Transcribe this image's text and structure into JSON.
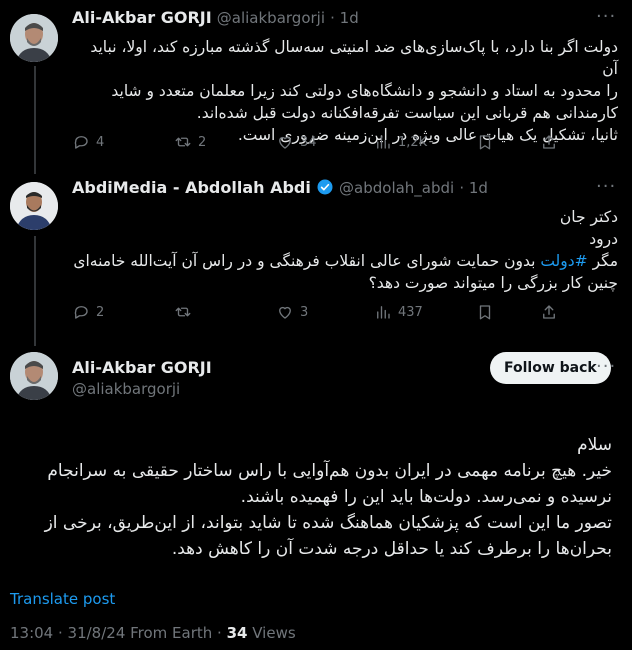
{
  "tweet1": {
    "name": "Ali-Akbar GORJI",
    "handle": "@aliakbargorji",
    "time": "· 1d",
    "lines": [
      "دولت اگر بنا دارد، با پاک‌سازی‌های ضد امنیتی سه‌سال گذشته مبارزه کند، اولا، نباید آن",
      "را محدود به استاد و دانشجو و دانشگاه‌های دولتی کند زیرا معلمان متعدد و شاید",
      "کارمندانی هم قربانی این سیاست تفرقه‌افکنانه دولت قبل شده‌اند.",
      "ثانیا، تشکیل یک هیات عالی ویژه در این‌زمینه ضروری است."
    ],
    "replies": "4",
    "retweets": "2",
    "likes": "34",
    "views": "1,2K"
  },
  "tweet2": {
    "name": "AbdiMedia - Abdollah Abdi",
    "handle": "@abdolah_abdi",
    "time": "· 1d",
    "line1": "دکتر جان",
    "line2": "درود",
    "line3_pre": "مگر ",
    "hashtag": "#دولت",
    "line3_post": " بدون حمایت شورای عالی انقلاب فرهنگی و در راس آن آیت‌الله خامنه‌ای",
    "line4": "چنین کار بزرگی را میتواند صورت دهد؟",
    "replies": "2",
    "retweets": "",
    "likes": "3",
    "views": "437"
  },
  "tweet3": {
    "name": "Ali-Akbar GORJI",
    "handle": "@aliakbargorji",
    "follow_label": "Follow back",
    "lines": [
      "سلام",
      "خیر. هیچ برنامه مهمی در ایران بدون هم‌آوایی با راس ساختار حقیقی به سرانجام",
      "نرسیده و نمی‌رسد. دولت‌ها باید این را فهمیده باشند.",
      "تصور ما این است که پزشکیان هماهنگ شده  تا  شاید بتواند، از این‌طریق، برخی از",
      "بحران‌ها را برطرف کند یا  حداقل درجه شدت آن را کاهش دهد."
    ],
    "translate": "Translate post",
    "timestamp": "13:04 · 31/8/24 From Earth · ",
    "views_count": "34",
    "views_label": " Views"
  },
  "icons": [
    "more-icon",
    "reply-icon",
    "retweet-icon",
    "like-icon",
    "views-icon",
    "bookmark-icon",
    "share-icon",
    "verified-icon"
  ],
  "colors": {
    "background": "#000000",
    "text": "#e7e9ea",
    "muted": "#71767b",
    "accent": "#1d9bf0",
    "divider": "#2f3336"
  }
}
